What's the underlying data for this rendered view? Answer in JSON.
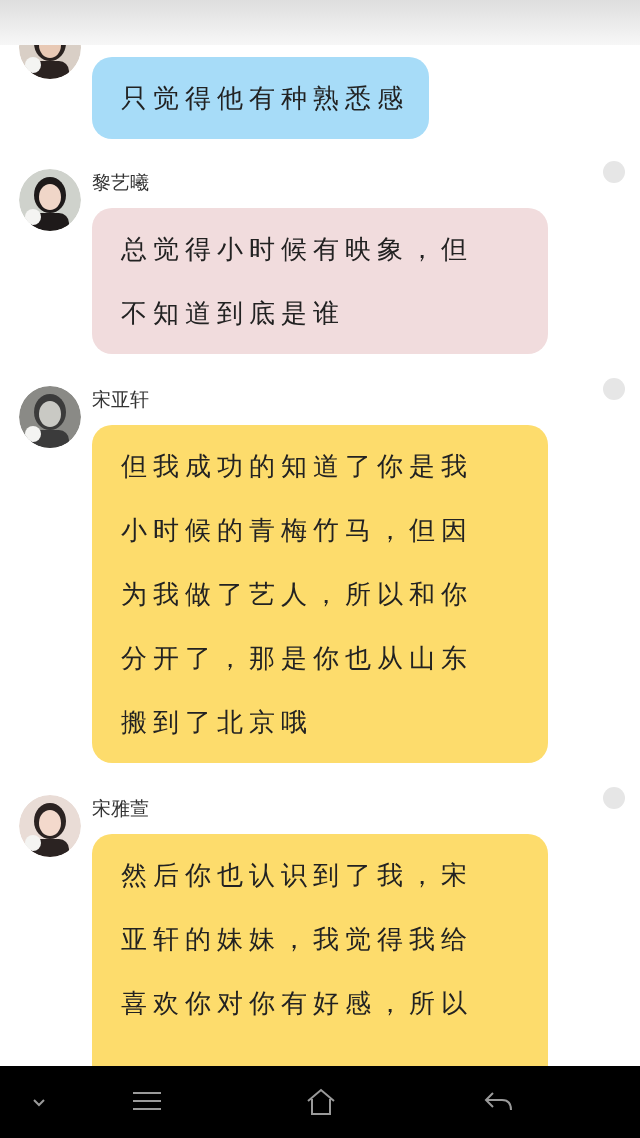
{
  "messages": [
    {
      "lines": [
        "只觉得他有种熟悉感"
      ],
      "color": "#a7dcf8"
    },
    {
      "name": "黎艺曦",
      "lines": [
        "总觉得小时候有映象，但",
        "不知道到底是谁"
      ],
      "color": "#f1dcdd"
    },
    {
      "name": "宋亚轩",
      "lines": [
        "但我成功的知道了你是我",
        "小时候的青梅竹马，但因",
        "为我做了艺人，所以和你",
        "分开了，那是你也从山东",
        "搬到了北京哦"
      ],
      "color": "#fddc6c"
    },
    {
      "name": "宋雅萱",
      "lines": [
        "然后你也认识到了我，宋",
        "亚轩的妹妹，我觉得我给",
        "喜欢你对你有好感，所以"
      ],
      "color": "#fddc6c"
    }
  ]
}
